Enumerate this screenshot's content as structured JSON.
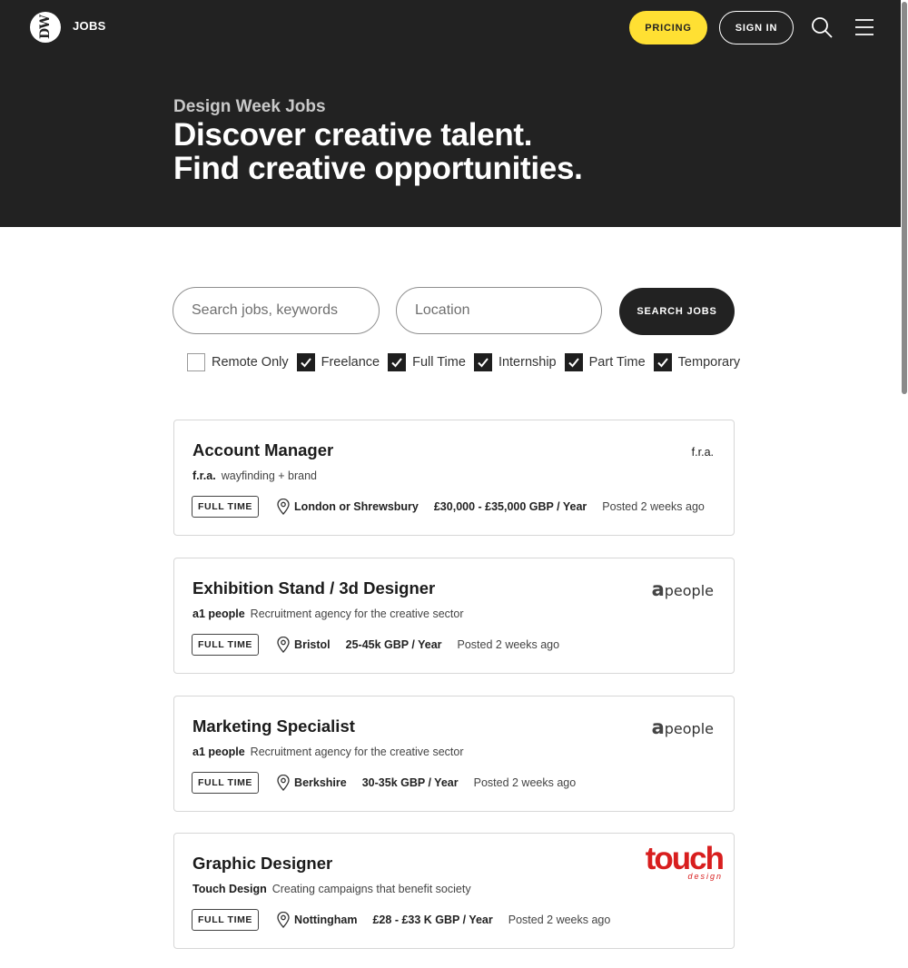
{
  "header": {
    "logo_text": "DW",
    "brand": "JOBS",
    "pricing_label": "PRICING",
    "signin_label": "SIGN IN"
  },
  "hero": {
    "subtitle": "Design Week Jobs",
    "line1": "Discover creative talent.",
    "line2": "Find creative opportunities."
  },
  "search": {
    "keywords_placeholder": "Search jobs, keywords",
    "location_placeholder": "Location",
    "button_label": "SEARCH JOBS"
  },
  "filters": [
    {
      "label": "Remote Only",
      "checked": false
    },
    {
      "label": "Freelance",
      "checked": true
    },
    {
      "label": "Full Time",
      "checked": true
    },
    {
      "label": "Internship",
      "checked": true
    },
    {
      "label": "Part Time",
      "checked": true
    },
    {
      "label": "Temporary",
      "checked": true
    }
  ],
  "jobs": [
    {
      "title": "Account Manager",
      "company": "f.r.a.",
      "tagline": "wayfinding + brand",
      "type": "FULL TIME",
      "location": "London or Shrewsbury",
      "salary": "£30,000 - £35,000 GBP / Year",
      "posted": "Posted 2 weeks ago",
      "logo": "f.r.a."
    },
    {
      "title": "Exhibition Stand / 3d Designer",
      "company": "a1 people",
      "tagline": "Recruitment agency for the creative sector",
      "type": "FULL TIME",
      "location": "Bristol",
      "salary": "25-45k GBP / Year",
      "posted": "Posted 2 weeks ago",
      "logo_mark": "a",
      "logo_word": "people"
    },
    {
      "title": "Marketing Specialist",
      "company": "a1 people",
      "tagline": "Recruitment agency for the creative sector",
      "type": "FULL TIME",
      "location": "Berkshire",
      "salary": "30-35k GBP / Year",
      "posted": "Posted 2 weeks ago",
      "logo_mark": "a",
      "logo_word": "people"
    },
    {
      "title": "Graphic Designer",
      "company": "Touch Design",
      "tagline": "Creating campaigns that benefit society",
      "type": "FULL TIME",
      "location": "Nottingham",
      "salary": "£28 - £33 K GBP / Year",
      "posted": "Posted 2 weeks ago",
      "logo_word": "touch",
      "logo_sub": "design"
    }
  ],
  "colors": {
    "hero_bg": "#222222",
    "accent_yellow": "#ffe033",
    "touch_red": "#d81e1e"
  }
}
